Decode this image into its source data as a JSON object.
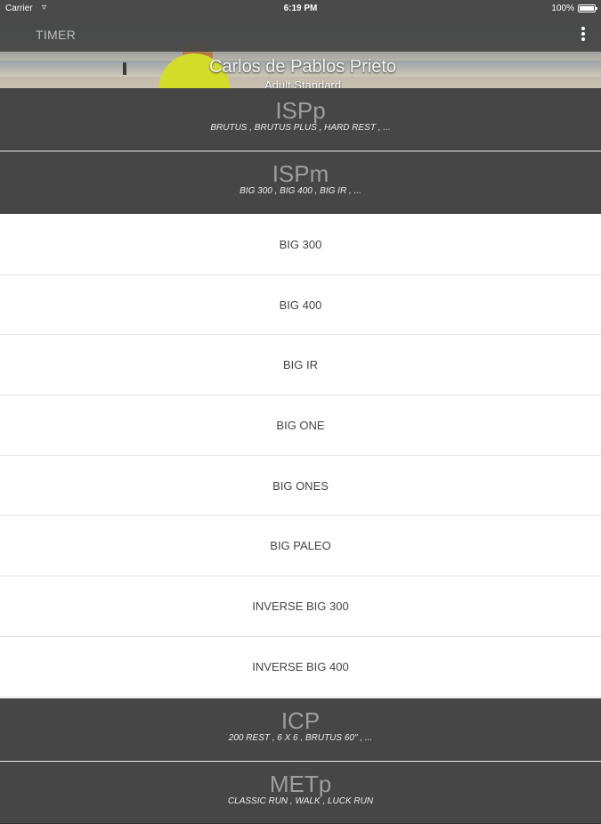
{
  "status_bar": {
    "carrier": "Carrier",
    "time": "6:19 PM",
    "battery": "100%"
  },
  "banner": {
    "title": "Carlos de Pablos Prieto",
    "subtitle": "Adult Standard"
  },
  "nav": {
    "title": "TIMER"
  },
  "groups_top": [
    {
      "title": "ISPp",
      "subtitle": "BRUTUS , BRUTUS PLUS , HARD REST , ..."
    },
    {
      "title": "ISPm",
      "subtitle": "BIG 300 , BIG 400 , BIG IR , ..."
    }
  ],
  "exercises": [
    "BIG 300",
    "BIG 400",
    "BIG IR",
    "BIG ONE",
    "BIG ONES",
    "BIG PALEO",
    "INVERSE BIG 300",
    "INVERSE BIG 400"
  ],
  "groups_bottom": [
    {
      "title": "ICP",
      "subtitle": "200 REST , 6 X 6 , BRUTUS 60\" , ..."
    },
    {
      "title": "METp",
      "subtitle": "CLASSIC RUN , WALK , LUCK RUN"
    }
  ],
  "colors": {
    "header_bg": "#464646",
    "nav_bg": "#464646",
    "list_bg": "#ffffff"
  }
}
